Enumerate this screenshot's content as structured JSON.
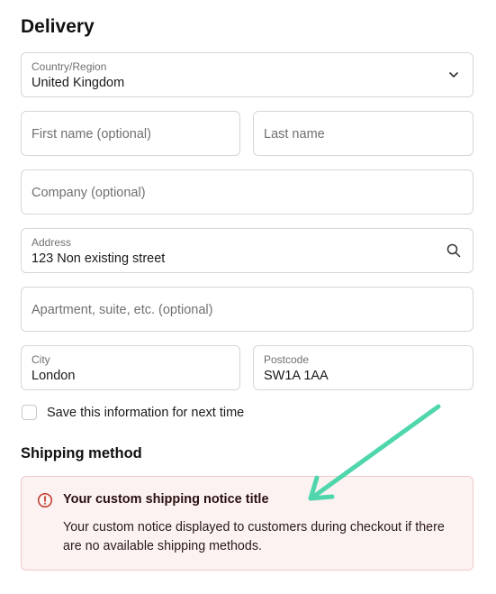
{
  "delivery": {
    "title": "Delivery",
    "country": {
      "label": "Country/Region",
      "value": "United Kingdom"
    },
    "first_name": {
      "placeholder": "First name (optional)"
    },
    "last_name": {
      "placeholder": "Last name"
    },
    "company": {
      "placeholder": "Company (optional)"
    },
    "address": {
      "label": "Address",
      "value": "123 Non existing street"
    },
    "apartment": {
      "placeholder": "Apartment, suite, etc. (optional)"
    },
    "city": {
      "label": "City",
      "value": "London"
    },
    "postcode": {
      "label": "Postcode",
      "value": "SW1A 1AA"
    },
    "save_info_label": "Save this information for next time",
    "save_info_checked": false
  },
  "shipping": {
    "title": "Shipping method",
    "notice": {
      "title": "Your custom shipping notice title",
      "body": "Your custom notice displayed to customers during checkout if there are no available shipping methods."
    }
  },
  "colors": {
    "notice_bg": "#fdf2f2",
    "notice_border": "#f0c9c9",
    "error_icon": "#c0392b",
    "arrow": "#4fd6ad"
  },
  "icons": {
    "country_dropdown": "chevron-down-icon",
    "address_search": "search-icon",
    "notice": "error-circle-icon",
    "annotation": "arrow-icon"
  }
}
